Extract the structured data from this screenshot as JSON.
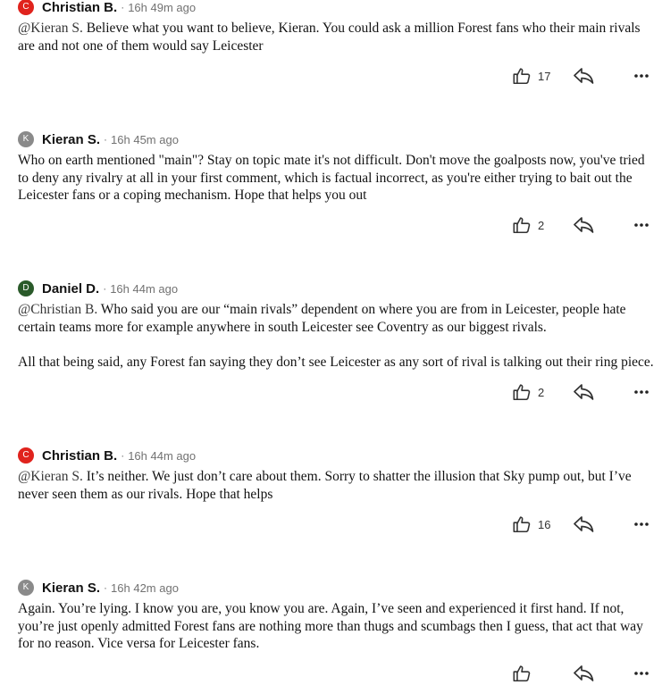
{
  "comments": [
    {
      "avatar_letter": "C",
      "avatar_color": "#e0231d",
      "name": "Christian B.",
      "separator": "·",
      "time": "16h 49m ago",
      "paragraphs": [
        {
          "mention": "@Kieran S.",
          "text": " Believe what you want to believe, Kieran. You could ask a million Forest fans who their main rivals are and not one of them would say Leicester"
        }
      ],
      "likes": "17"
    },
    {
      "avatar_letter": "K",
      "avatar_color": "#8a8a8a",
      "name": "Kieran S.",
      "separator": "·",
      "time": "16h 45m ago",
      "paragraphs": [
        {
          "mention": "",
          "text": "Who on earth mentioned \"main\"? Stay on topic mate it's not difficult. Don't move the goalposts now, you've tried to deny any rivalry at all in your first comment, which is factual incorrect, as you're either trying to bait out the Leicester fans or a coping mechanism. Hope that helps you out"
        }
      ],
      "likes": "2"
    },
    {
      "avatar_letter": "D",
      "avatar_color": "#2a5a2a",
      "name": "Daniel D.",
      "separator": "·",
      "time": "16h 44m ago",
      "paragraphs": [
        {
          "mention": "@Christian B.",
          "text": " Who said you are our “main rivals” dependent on where you are from in Leicester, people hate certain teams more for example anywhere in south Leicester see Coventry as our biggest rivals."
        },
        {
          "mention": "",
          "text": "All that being said, any Forest fan saying they don’t see Leicester as any sort of rival is talking out their ring piece."
        }
      ],
      "likes": "2"
    },
    {
      "avatar_letter": "C",
      "avatar_color": "#e0231d",
      "name": "Christian B.",
      "separator": "·",
      "time": "16h 44m ago",
      "paragraphs": [
        {
          "mention": "@Kieran S.",
          "text": " It’s neither. We just don’t care about them. Sorry to shatter the illusion that Sky pump out, but I’ve never seen them as our rivals. Hope that helps"
        }
      ],
      "likes": "16"
    },
    {
      "avatar_letter": "K",
      "avatar_color": "#8a8a8a",
      "name": "Kieran S.",
      "separator": "·",
      "time": "16h 42m ago",
      "paragraphs": [
        {
          "mention": "",
          "text": "Again. You’re lying. I know you are, you know you are. Again, I’ve seen and experienced it first hand. If not, you’re just openly admitted Forest fans are nothing more than thugs and scumbags then I guess, that act that way for no reason. Vice versa for Leicester fans."
        }
      ],
      "likes": ""
    }
  ],
  "icons": {
    "like": "thumbs-up-icon",
    "reply": "reply-arrow-icon",
    "more": "more-dots-icon"
  }
}
